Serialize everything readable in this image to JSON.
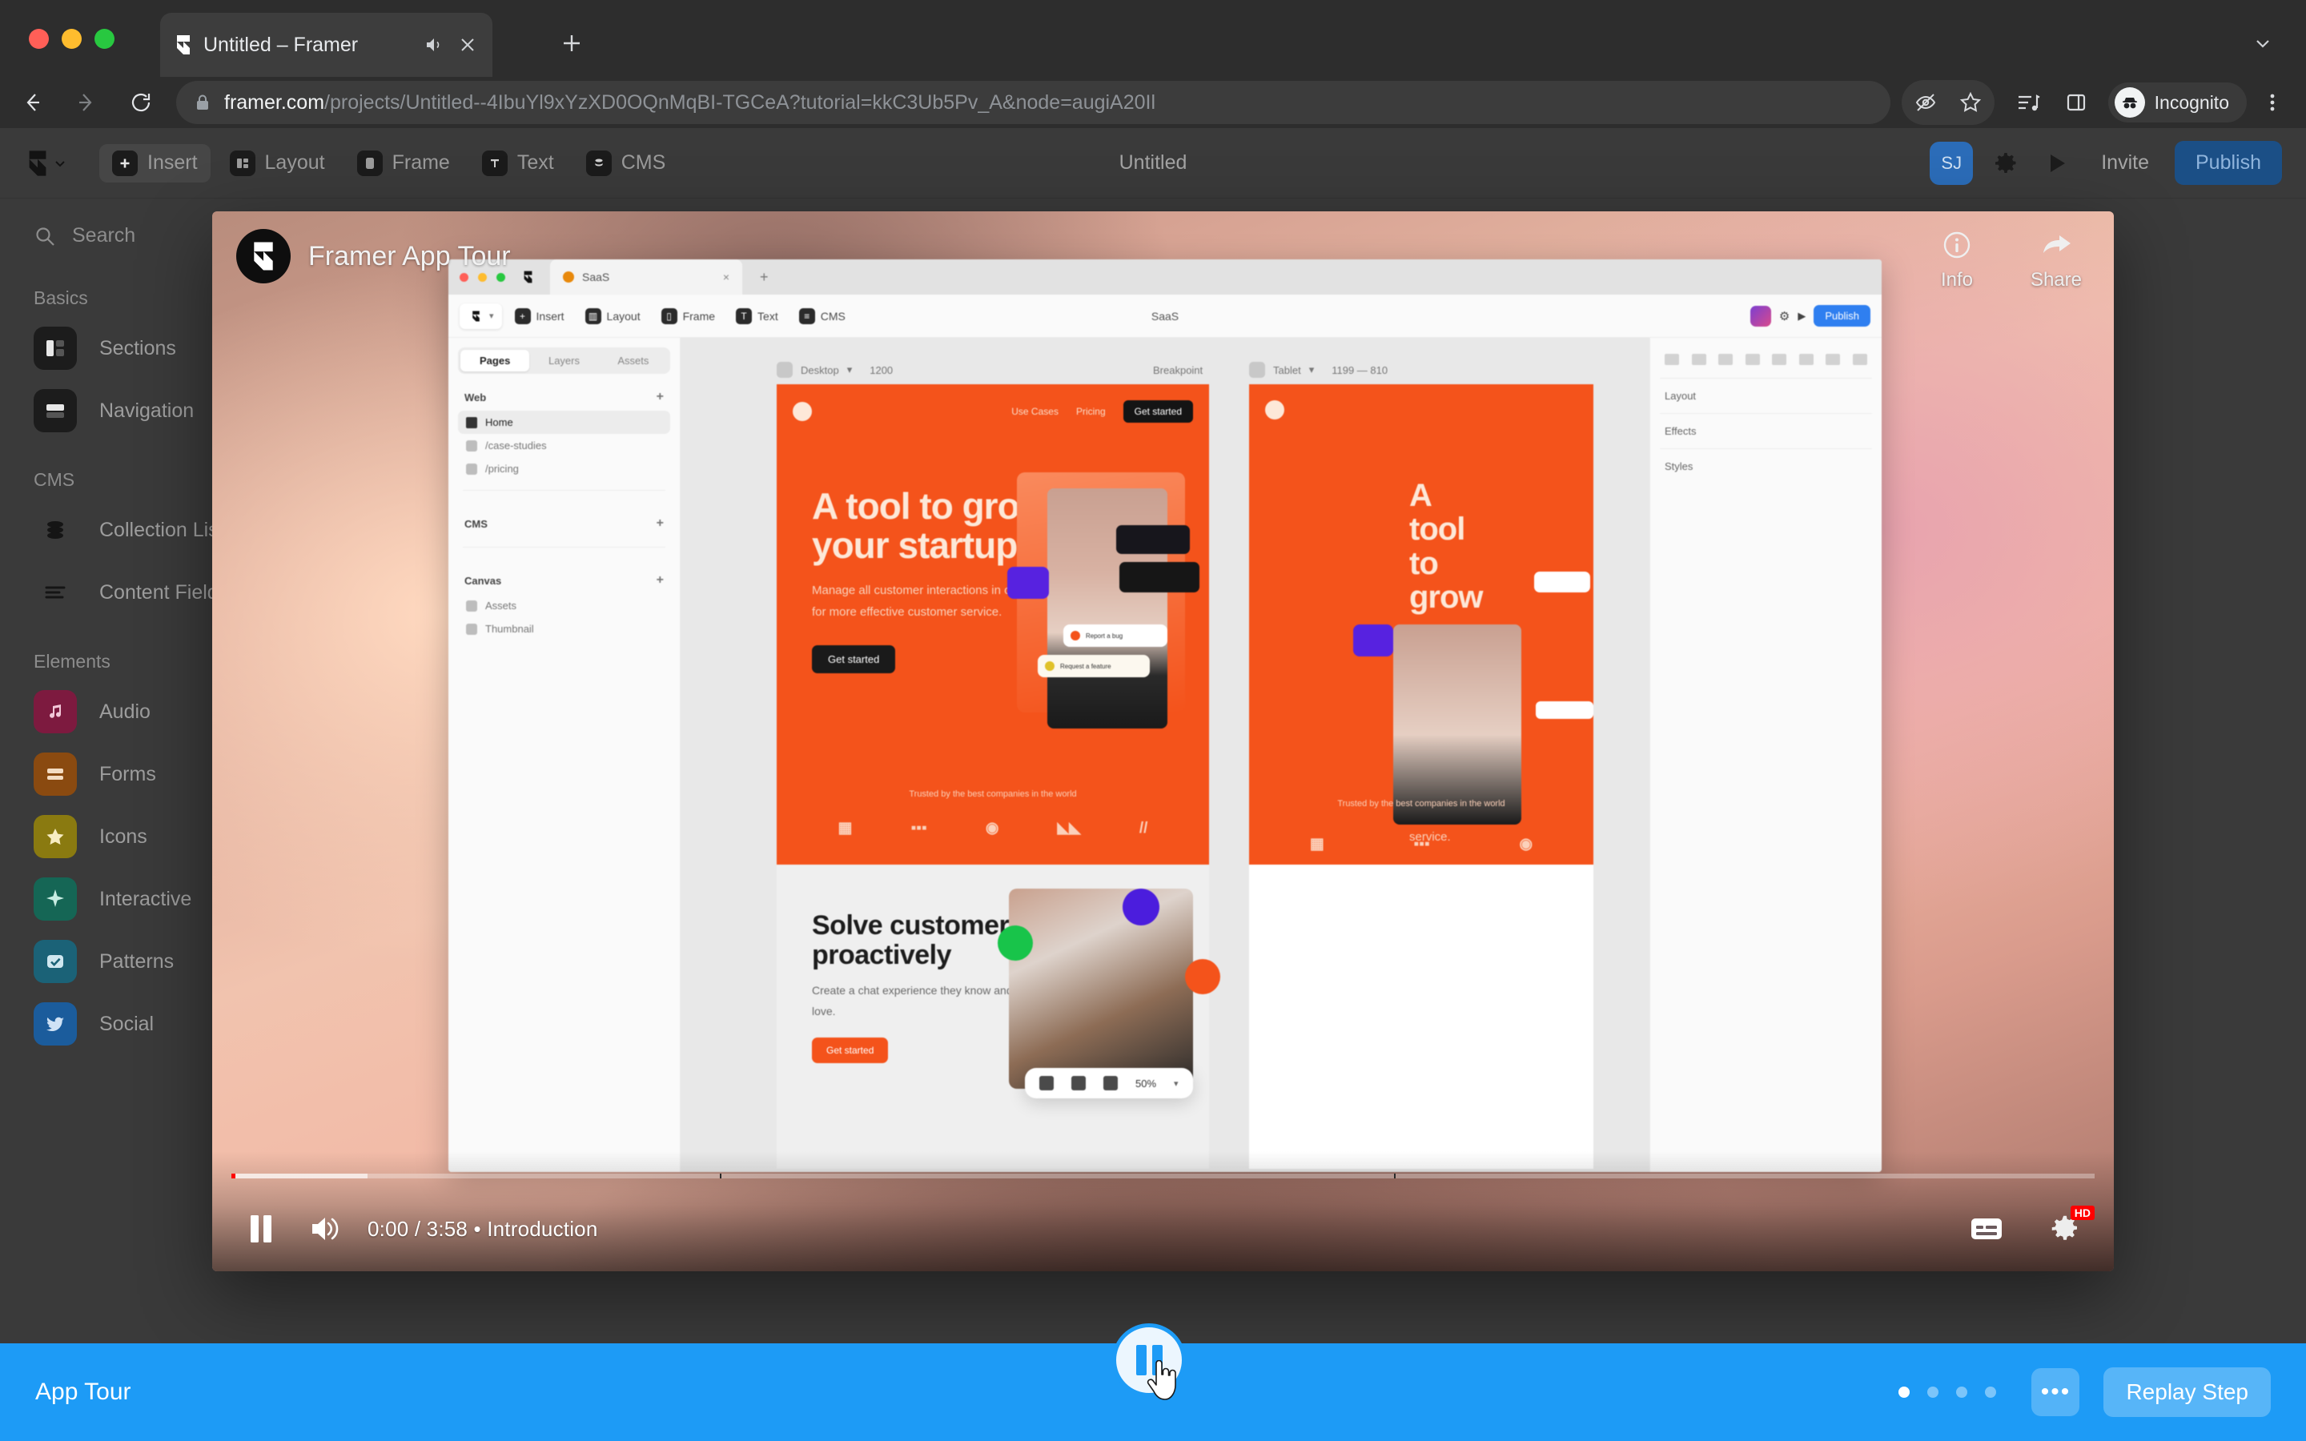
{
  "browser": {
    "tab": {
      "title": "Untitled – Framer",
      "mute_icon": "speaker-icon",
      "close_icon": "close-icon"
    },
    "new_tab_label": "+",
    "url_domain": "framer.com",
    "url_path": "/projects/Untitled--4IbuYl9xYzXD0OQnMqBI-TGCeA?tutorial=kkC3Ub5Pv_A&node=augiA20Il",
    "profile_label": "Incognito",
    "icons": {
      "back": "back-arrow-icon",
      "forward": "forward-arrow-icon",
      "reload": "reload-icon",
      "lock": "lock-icon",
      "eye_off": "eye-off-icon",
      "bookmark": "star-icon",
      "media": "media-playlist-icon",
      "side_panel": "side-panel-icon",
      "menu": "three-dot-menu-icon"
    }
  },
  "framer": {
    "logo_label": "framer-logo",
    "toolbar": [
      {
        "label": "Insert",
        "icon": "plus-icon",
        "active": true
      },
      {
        "label": "Layout",
        "icon": "layout-icon",
        "active": false
      },
      {
        "label": "Frame",
        "icon": "frame-icon",
        "active": false
      },
      {
        "label": "Text",
        "icon": "text-icon",
        "active": false
      },
      {
        "label": "CMS",
        "icon": "cms-icon",
        "active": false
      }
    ],
    "project_title": "Untitled",
    "avatar_initials": "SJ",
    "invite_label": "Invite",
    "publish_label": "Publish",
    "search_placeholder": "Search",
    "sidebar": [
      {
        "type": "group",
        "label": "Basics"
      },
      {
        "type": "item",
        "label": "Sections",
        "icon": "sections-icon",
        "color": "#1c1c1c"
      },
      {
        "type": "item",
        "label": "Navigation",
        "icon": "navigation-icon",
        "color": "#1c1c1c"
      },
      {
        "type": "group",
        "label": "CMS"
      },
      {
        "type": "item",
        "label": "Collection List",
        "icon": "database-icon",
        "color": "#1c1c1c"
      },
      {
        "type": "item",
        "label": "Content Fields",
        "icon": "content-fields-icon",
        "color": "#1c1c1c"
      },
      {
        "type": "group",
        "label": "Elements"
      },
      {
        "type": "item",
        "label": "Audio",
        "icon": "music-note-icon",
        "color": "#7d1a3f"
      },
      {
        "type": "item",
        "label": "Forms",
        "icon": "form-icon",
        "color": "#8a4a10"
      },
      {
        "type": "item",
        "label": "Icons",
        "icon": "star-icon",
        "color": "#8a7a10"
      },
      {
        "type": "item",
        "label": "Interactive",
        "icon": "spark-icon",
        "color": "#156655"
      },
      {
        "type": "item",
        "label": "Patterns",
        "icon": "checkbox-icon",
        "color": "#1b6277"
      },
      {
        "type": "item",
        "label": "Social",
        "icon": "twitter-bird-icon",
        "color": "#1b5c9c",
        "chevron": "›"
      }
    ]
  },
  "video": {
    "title": "Framer App Tour",
    "logo": "framer-logo-circle",
    "actions": [
      {
        "label": "Info",
        "icon": "info-icon"
      },
      {
        "label": "Share",
        "icon": "share-arrow-icon"
      }
    ],
    "controls": {
      "play_state_icon": "pause-icon",
      "volume_icon": "volume-on-icon",
      "time": "0:00 / 3:58 • Introduction",
      "current_time": "0:00",
      "duration": "3:58",
      "chapter": "Introduction",
      "subtitles_icon": "subtitles-icon",
      "settings_icon": "gear-icon",
      "quality_badge": "HD"
    },
    "screen": {
      "tab_label": "SaaS",
      "toolbar": [
        "Insert",
        "Layout",
        "Frame",
        "Text",
        "CMS"
      ],
      "project_title": "SaaS",
      "publish_label": "Publish",
      "panel_tabs": [
        "Pages",
        "Layers",
        "Assets"
      ],
      "active_panel_tab": "Pages",
      "pages": [
        {
          "section": "Web",
          "items": [
            {
              "label": "Home",
              "active": true
            },
            {
              "label": "/case-studies",
              "active": false
            },
            {
              "label": "/pricing",
              "active": false
            }
          ]
        },
        {
          "section": "CMS",
          "items": []
        },
        {
          "section": "Canvas",
          "items": [
            {
              "label": "Assets",
              "active": false
            },
            {
              "label": "Thumbnail",
              "active": false
            }
          ]
        }
      ],
      "right_panel": [
        "Layout",
        "Effects",
        "Styles"
      ],
      "frames": [
        {
          "name": "Desktop",
          "size": "1200",
          "breakpoint_label": "Breakpoint"
        },
        {
          "name": "Tablet",
          "size": "1199 — 810"
        }
      ],
      "hero": {
        "nav": [
          "Use Cases",
          "Pricing"
        ],
        "nav_cta": "Get started",
        "heading": "A tool to grow your startup",
        "body": "Manage all customer interactions in one place for more effective customer service.",
        "cta": "Get started",
        "trusted": "Trusted by the best companies in the world",
        "cards": [
          "Report a bug",
          "Request a feature"
        ]
      },
      "hero2": {
        "heading": "Solve customer problems proactively",
        "body": "Create a chat experience they know and love.",
        "cta": "Get started"
      },
      "canvas_zoom": "50%"
    }
  },
  "tour": {
    "label": "App Tour",
    "steps_total": 4,
    "current_step": 1,
    "more_label": "•••",
    "replay_label": "Replay Step",
    "pause_icon": "pause-icon",
    "accent": "#1d9bf6"
  }
}
